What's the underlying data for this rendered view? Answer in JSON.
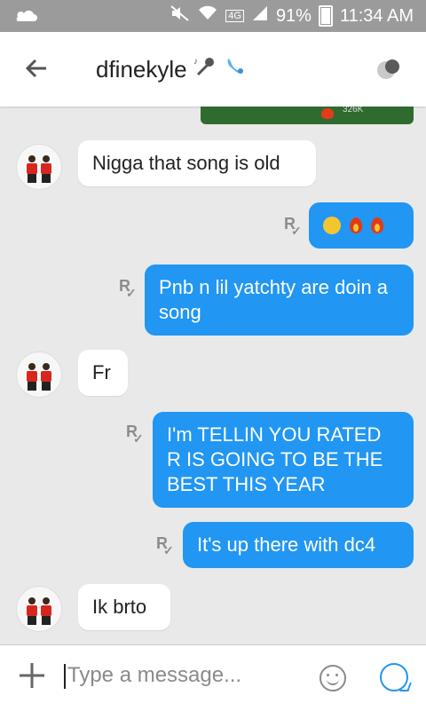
{
  "status": {
    "network": "4G",
    "battery": "91%",
    "time": "11:34 AM"
  },
  "header": {
    "title": "dfinekyle",
    "back_icon": "arrow-left-icon",
    "title_icons": [
      "microphone-icon",
      "water-drop-icon"
    ]
  },
  "preview": {
    "count": "326K"
  },
  "messages": [
    {
      "dir": "in",
      "text": "Nigga that song is old"
    },
    {
      "dir": "out",
      "text": ""
    },
    {
      "dir": "out",
      "text": "Pnb n lil yatchty are doin a song"
    },
    {
      "dir": "in",
      "text": "Fr"
    },
    {
      "dir": "out",
      "text": "I'm TELLIN YOU RATED R IS GOING TO BE THE BEST THIS YEAR"
    },
    {
      "dir": "out",
      "text": "It's up there with dc4"
    },
    {
      "dir": "in",
      "text": "Ik brto"
    }
  ],
  "input": {
    "placeholder": "Type a message..."
  },
  "colors": {
    "outgoing": "#2196f3",
    "incoming": "#ffffff",
    "background": "#e9e9e9"
  }
}
